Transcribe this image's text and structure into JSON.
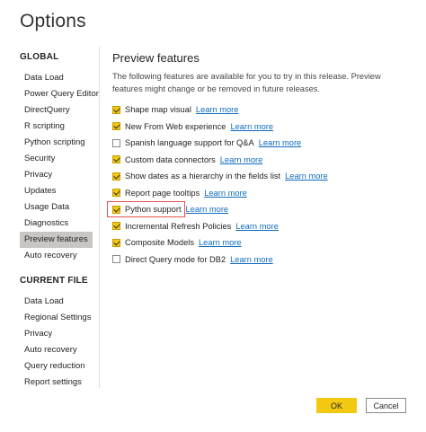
{
  "dialog": {
    "title": "Options"
  },
  "sidebar": {
    "global_header": "GLOBAL",
    "global_items": [
      {
        "label": "Data Load",
        "active": false
      },
      {
        "label": "Power Query Editor",
        "active": false
      },
      {
        "label": "DirectQuery",
        "active": false
      },
      {
        "label": "R scripting",
        "active": false
      },
      {
        "label": "Python scripting",
        "active": false
      },
      {
        "label": "Security",
        "active": false
      },
      {
        "label": "Privacy",
        "active": false
      },
      {
        "label": "Updates",
        "active": false
      },
      {
        "label": "Usage Data",
        "active": false
      },
      {
        "label": "Diagnostics",
        "active": false
      },
      {
        "label": "Preview features",
        "active": true
      },
      {
        "label": "Auto recovery",
        "active": false
      }
    ],
    "current_header": "CURRENT FILE",
    "current_items": [
      {
        "label": "Data Load"
      },
      {
        "label": "Regional Settings"
      },
      {
        "label": "Privacy"
      },
      {
        "label": "Auto recovery"
      },
      {
        "label": "Query reduction"
      },
      {
        "label": "Report settings"
      }
    ]
  },
  "main": {
    "title": "Preview features",
    "description": "The following features are available for you to try in this release. Preview features might change or be removed in future releases.",
    "learn_more": "Learn more",
    "features": [
      {
        "label": "Shape map visual",
        "checked": true,
        "highlighted": false
      },
      {
        "label": "New From Web experience",
        "checked": true,
        "highlighted": false
      },
      {
        "label": "Spanish language support for Q&A",
        "checked": false,
        "highlighted": false
      },
      {
        "label": "Custom data connectors",
        "checked": true,
        "highlighted": false
      },
      {
        "label": "Show dates as a hierarchy in the fields list",
        "checked": true,
        "highlighted": false
      },
      {
        "label": "Report page tooltips",
        "checked": true,
        "highlighted": false
      },
      {
        "label": "Python support",
        "checked": true,
        "highlighted": true
      },
      {
        "label": "Incremental Refresh Policies",
        "checked": true,
        "highlighted": false
      },
      {
        "label": "Composite Models",
        "checked": true,
        "highlighted": false
      },
      {
        "label": "Direct Query mode for DB2",
        "checked": false,
        "highlighted": false
      }
    ]
  },
  "buttons": {
    "ok": "OK",
    "cancel": "Cancel"
  },
  "colors": {
    "accent": "#f2c811",
    "link": "#0f6cbd",
    "highlight": "#e8504f",
    "active_nav": "#c8c6c4"
  },
  "icons": {
    "checkbox_checked": "checkmark-icon"
  }
}
